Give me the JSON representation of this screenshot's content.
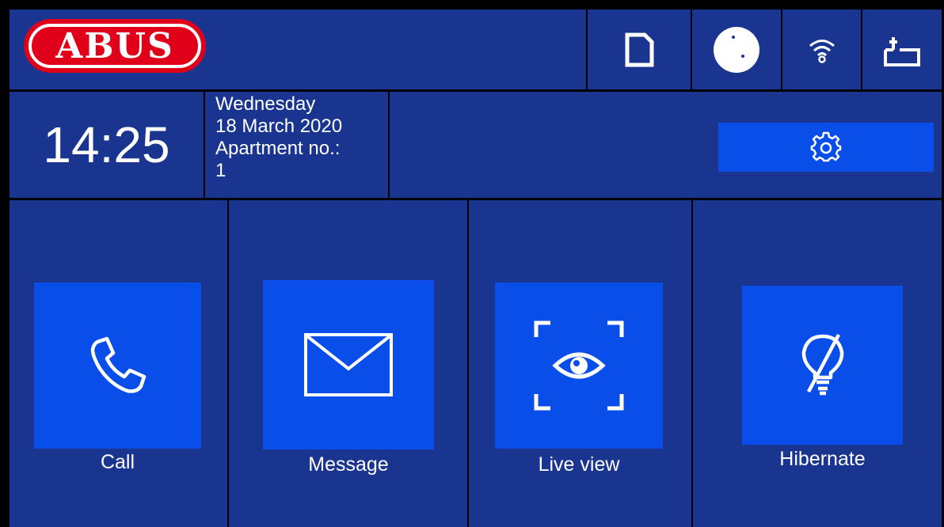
{
  "header": {
    "logo_text": "ABUS"
  },
  "status_icons": [
    {
      "name": "sd-card-icon"
    },
    {
      "name": "disc-icon"
    },
    {
      "name": "wifi-icon"
    },
    {
      "name": "network-port-icon"
    }
  ],
  "info": {
    "time": "14:25",
    "weekday": "Wednesday",
    "date": "18 March 2020",
    "apartment_label": "Apartment no.:",
    "apartment_number": "1"
  },
  "settings": {
    "icon": "gear-icon"
  },
  "tiles": [
    {
      "label": "Call",
      "icon": "phone-icon"
    },
    {
      "label": "Message",
      "icon": "envelope-icon"
    },
    {
      "label": "Live view",
      "icon": "eye-icon"
    },
    {
      "label": "Hibernate",
      "icon": "bulb-off-icon"
    }
  ],
  "colors": {
    "background": "#1a3590",
    "tile": "#0a4eea",
    "logo_red": "#e1001a",
    "border": "#000000",
    "text": "#ffffff"
  }
}
